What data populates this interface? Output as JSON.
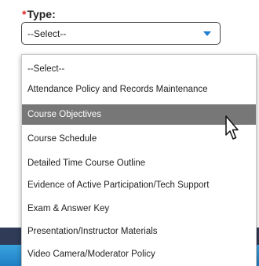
{
  "form": {
    "required_marker": "*",
    "type_label": "Type:",
    "select_value": "--Select--",
    "caret_icon": "caret-down-icon",
    "accent_color": "#1e7fd0",
    "required_color": "#d9262a"
  },
  "dropdown": {
    "options": [
      "--Select--",
      "Attendance Policy and Records Maintenance",
      "Course Objectives",
      "Course Schedule",
      "Detailed Time Course Outline",
      "Evidence of Active Participation/Tech Support",
      "Exam & Answer Key",
      "Presentation/Instructor Materials",
      "Video Camera/Moderator Policy"
    ],
    "highlighted_option": "Course Objectives",
    "highlight_color": "#777777"
  },
  "cursor": {
    "icon": "pointer-cursor-icon"
  }
}
